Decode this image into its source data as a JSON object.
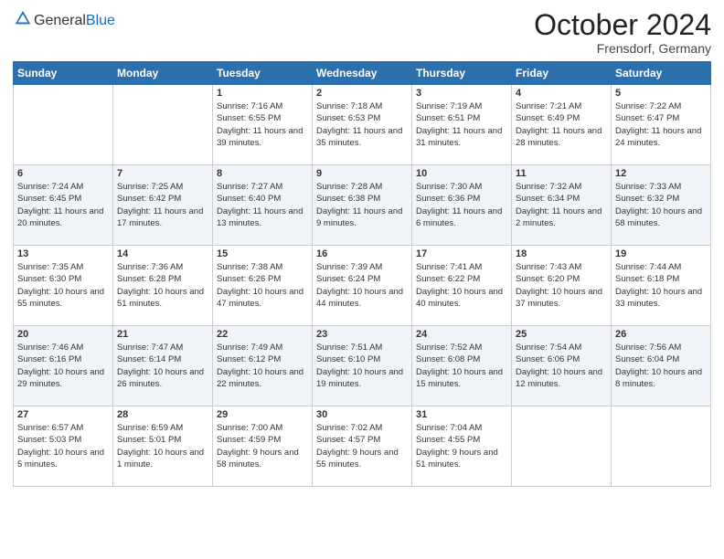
{
  "header": {
    "logo_general": "General",
    "logo_blue": "Blue",
    "month": "October 2024",
    "location": "Frensdorf, Germany"
  },
  "days_of_week": [
    "Sunday",
    "Monday",
    "Tuesday",
    "Wednesday",
    "Thursday",
    "Friday",
    "Saturday"
  ],
  "weeks": [
    [
      {
        "day": "",
        "sunrise": "",
        "sunset": "",
        "daylight": ""
      },
      {
        "day": "",
        "sunrise": "",
        "sunset": "",
        "daylight": ""
      },
      {
        "day": "1",
        "sunrise": "Sunrise: 7:16 AM",
        "sunset": "Sunset: 6:55 PM",
        "daylight": "Daylight: 11 hours and 39 minutes."
      },
      {
        "day": "2",
        "sunrise": "Sunrise: 7:18 AM",
        "sunset": "Sunset: 6:53 PM",
        "daylight": "Daylight: 11 hours and 35 minutes."
      },
      {
        "day": "3",
        "sunrise": "Sunrise: 7:19 AM",
        "sunset": "Sunset: 6:51 PM",
        "daylight": "Daylight: 11 hours and 31 minutes."
      },
      {
        "day": "4",
        "sunrise": "Sunrise: 7:21 AM",
        "sunset": "Sunset: 6:49 PM",
        "daylight": "Daylight: 11 hours and 28 minutes."
      },
      {
        "day": "5",
        "sunrise": "Sunrise: 7:22 AM",
        "sunset": "Sunset: 6:47 PM",
        "daylight": "Daylight: 11 hours and 24 minutes."
      }
    ],
    [
      {
        "day": "6",
        "sunrise": "Sunrise: 7:24 AM",
        "sunset": "Sunset: 6:45 PM",
        "daylight": "Daylight: 11 hours and 20 minutes."
      },
      {
        "day": "7",
        "sunrise": "Sunrise: 7:25 AM",
        "sunset": "Sunset: 6:42 PM",
        "daylight": "Daylight: 11 hours and 17 minutes."
      },
      {
        "day": "8",
        "sunrise": "Sunrise: 7:27 AM",
        "sunset": "Sunset: 6:40 PM",
        "daylight": "Daylight: 11 hours and 13 minutes."
      },
      {
        "day": "9",
        "sunrise": "Sunrise: 7:28 AM",
        "sunset": "Sunset: 6:38 PM",
        "daylight": "Daylight: 11 hours and 9 minutes."
      },
      {
        "day": "10",
        "sunrise": "Sunrise: 7:30 AM",
        "sunset": "Sunset: 6:36 PM",
        "daylight": "Daylight: 11 hours and 6 minutes."
      },
      {
        "day": "11",
        "sunrise": "Sunrise: 7:32 AM",
        "sunset": "Sunset: 6:34 PM",
        "daylight": "Daylight: 11 hours and 2 minutes."
      },
      {
        "day": "12",
        "sunrise": "Sunrise: 7:33 AM",
        "sunset": "Sunset: 6:32 PM",
        "daylight": "Daylight: 10 hours and 58 minutes."
      }
    ],
    [
      {
        "day": "13",
        "sunrise": "Sunrise: 7:35 AM",
        "sunset": "Sunset: 6:30 PM",
        "daylight": "Daylight: 10 hours and 55 minutes."
      },
      {
        "day": "14",
        "sunrise": "Sunrise: 7:36 AM",
        "sunset": "Sunset: 6:28 PM",
        "daylight": "Daylight: 10 hours and 51 minutes."
      },
      {
        "day": "15",
        "sunrise": "Sunrise: 7:38 AM",
        "sunset": "Sunset: 6:26 PM",
        "daylight": "Daylight: 10 hours and 47 minutes."
      },
      {
        "day": "16",
        "sunrise": "Sunrise: 7:39 AM",
        "sunset": "Sunset: 6:24 PM",
        "daylight": "Daylight: 10 hours and 44 minutes."
      },
      {
        "day": "17",
        "sunrise": "Sunrise: 7:41 AM",
        "sunset": "Sunset: 6:22 PM",
        "daylight": "Daylight: 10 hours and 40 minutes."
      },
      {
        "day": "18",
        "sunrise": "Sunrise: 7:43 AM",
        "sunset": "Sunset: 6:20 PM",
        "daylight": "Daylight: 10 hours and 37 minutes."
      },
      {
        "day": "19",
        "sunrise": "Sunrise: 7:44 AM",
        "sunset": "Sunset: 6:18 PM",
        "daylight": "Daylight: 10 hours and 33 minutes."
      }
    ],
    [
      {
        "day": "20",
        "sunrise": "Sunrise: 7:46 AM",
        "sunset": "Sunset: 6:16 PM",
        "daylight": "Daylight: 10 hours and 29 minutes."
      },
      {
        "day": "21",
        "sunrise": "Sunrise: 7:47 AM",
        "sunset": "Sunset: 6:14 PM",
        "daylight": "Daylight: 10 hours and 26 minutes."
      },
      {
        "day": "22",
        "sunrise": "Sunrise: 7:49 AM",
        "sunset": "Sunset: 6:12 PM",
        "daylight": "Daylight: 10 hours and 22 minutes."
      },
      {
        "day": "23",
        "sunrise": "Sunrise: 7:51 AM",
        "sunset": "Sunset: 6:10 PM",
        "daylight": "Daylight: 10 hours and 19 minutes."
      },
      {
        "day": "24",
        "sunrise": "Sunrise: 7:52 AM",
        "sunset": "Sunset: 6:08 PM",
        "daylight": "Daylight: 10 hours and 15 minutes."
      },
      {
        "day": "25",
        "sunrise": "Sunrise: 7:54 AM",
        "sunset": "Sunset: 6:06 PM",
        "daylight": "Daylight: 10 hours and 12 minutes."
      },
      {
        "day": "26",
        "sunrise": "Sunrise: 7:56 AM",
        "sunset": "Sunset: 6:04 PM",
        "daylight": "Daylight: 10 hours and 8 minutes."
      }
    ],
    [
      {
        "day": "27",
        "sunrise": "Sunrise: 6:57 AM",
        "sunset": "Sunset: 5:03 PM",
        "daylight": "Daylight: 10 hours and 5 minutes."
      },
      {
        "day": "28",
        "sunrise": "Sunrise: 6:59 AM",
        "sunset": "Sunset: 5:01 PM",
        "daylight": "Daylight: 10 hours and 1 minute."
      },
      {
        "day": "29",
        "sunrise": "Sunrise: 7:00 AM",
        "sunset": "Sunset: 4:59 PM",
        "daylight": "Daylight: 9 hours and 58 minutes."
      },
      {
        "day": "30",
        "sunrise": "Sunrise: 7:02 AM",
        "sunset": "Sunset: 4:57 PM",
        "daylight": "Daylight: 9 hours and 55 minutes."
      },
      {
        "day": "31",
        "sunrise": "Sunrise: 7:04 AM",
        "sunset": "Sunset: 4:55 PM",
        "daylight": "Daylight: 9 hours and 51 minutes."
      },
      {
        "day": "",
        "sunrise": "",
        "sunset": "",
        "daylight": ""
      },
      {
        "day": "",
        "sunrise": "",
        "sunset": "",
        "daylight": ""
      }
    ]
  ]
}
